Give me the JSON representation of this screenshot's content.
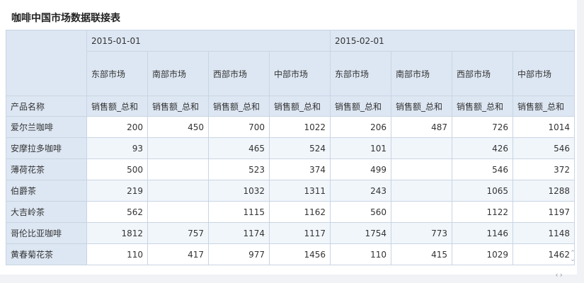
{
  "report": {
    "title": "咖啡中国市场数据联接表",
    "row_header": "产品名称",
    "dates": [
      "2015-01-01",
      "2015-02-01"
    ],
    "regions": [
      "东部市场",
      "南部市场",
      "西部市场",
      "中部市场",
      "东部市场",
      "南部市场",
      "西部市场",
      "中部市场"
    ],
    "measures": [
      "销售额_总和",
      "销售额_总和",
      "销售额_总和",
      "销售额_总和",
      "销售额_总和",
      "销售额_总和",
      "销售额_总和",
      "销售额_总和"
    ],
    "rows": [
      {
        "name": "爱尔兰咖啡",
        "values": [
          "200",
          "450",
          "700",
          "1022",
          "206",
          "487",
          "726",
          "1014"
        ]
      },
      {
        "name": "安摩拉多咖啡",
        "values": [
          "93",
          "",
          "465",
          "524",
          "101",
          "",
          "426",
          "546"
        ]
      },
      {
        "name": "薄荷花茶",
        "values": [
          "500",
          "",
          "523",
          "374",
          "499",
          "",
          "546",
          "372"
        ]
      },
      {
        "name": "伯爵茶",
        "values": [
          "219",
          "",
          "1032",
          "1311",
          "243",
          "",
          "1065",
          "1288"
        ]
      },
      {
        "name": "大吉岭茶",
        "values": [
          "562",
          "",
          "1115",
          "1162",
          "560",
          "",
          "1122",
          "1197"
        ]
      },
      {
        "name": "哥伦比亚咖啡",
        "values": [
          "1812",
          "757",
          "1174",
          "1117",
          "1754",
          "773",
          "1146",
          "1148"
        ]
      },
      {
        "name": "黄春菊花茶",
        "values": [
          "110",
          "417",
          "977",
          "1456",
          "110",
          "415",
          "1029",
          "1462"
        ]
      }
    ]
  },
  "icons": {
    "vertical_scroll": "up-down-chevron-icon",
    "horizontal_scroll": "left-right-chevron-icon"
  },
  "colors": {
    "header_bg": "#dde7f3",
    "alt_row_bg": "#f1f6fb",
    "border": "#c9d4e3"
  }
}
